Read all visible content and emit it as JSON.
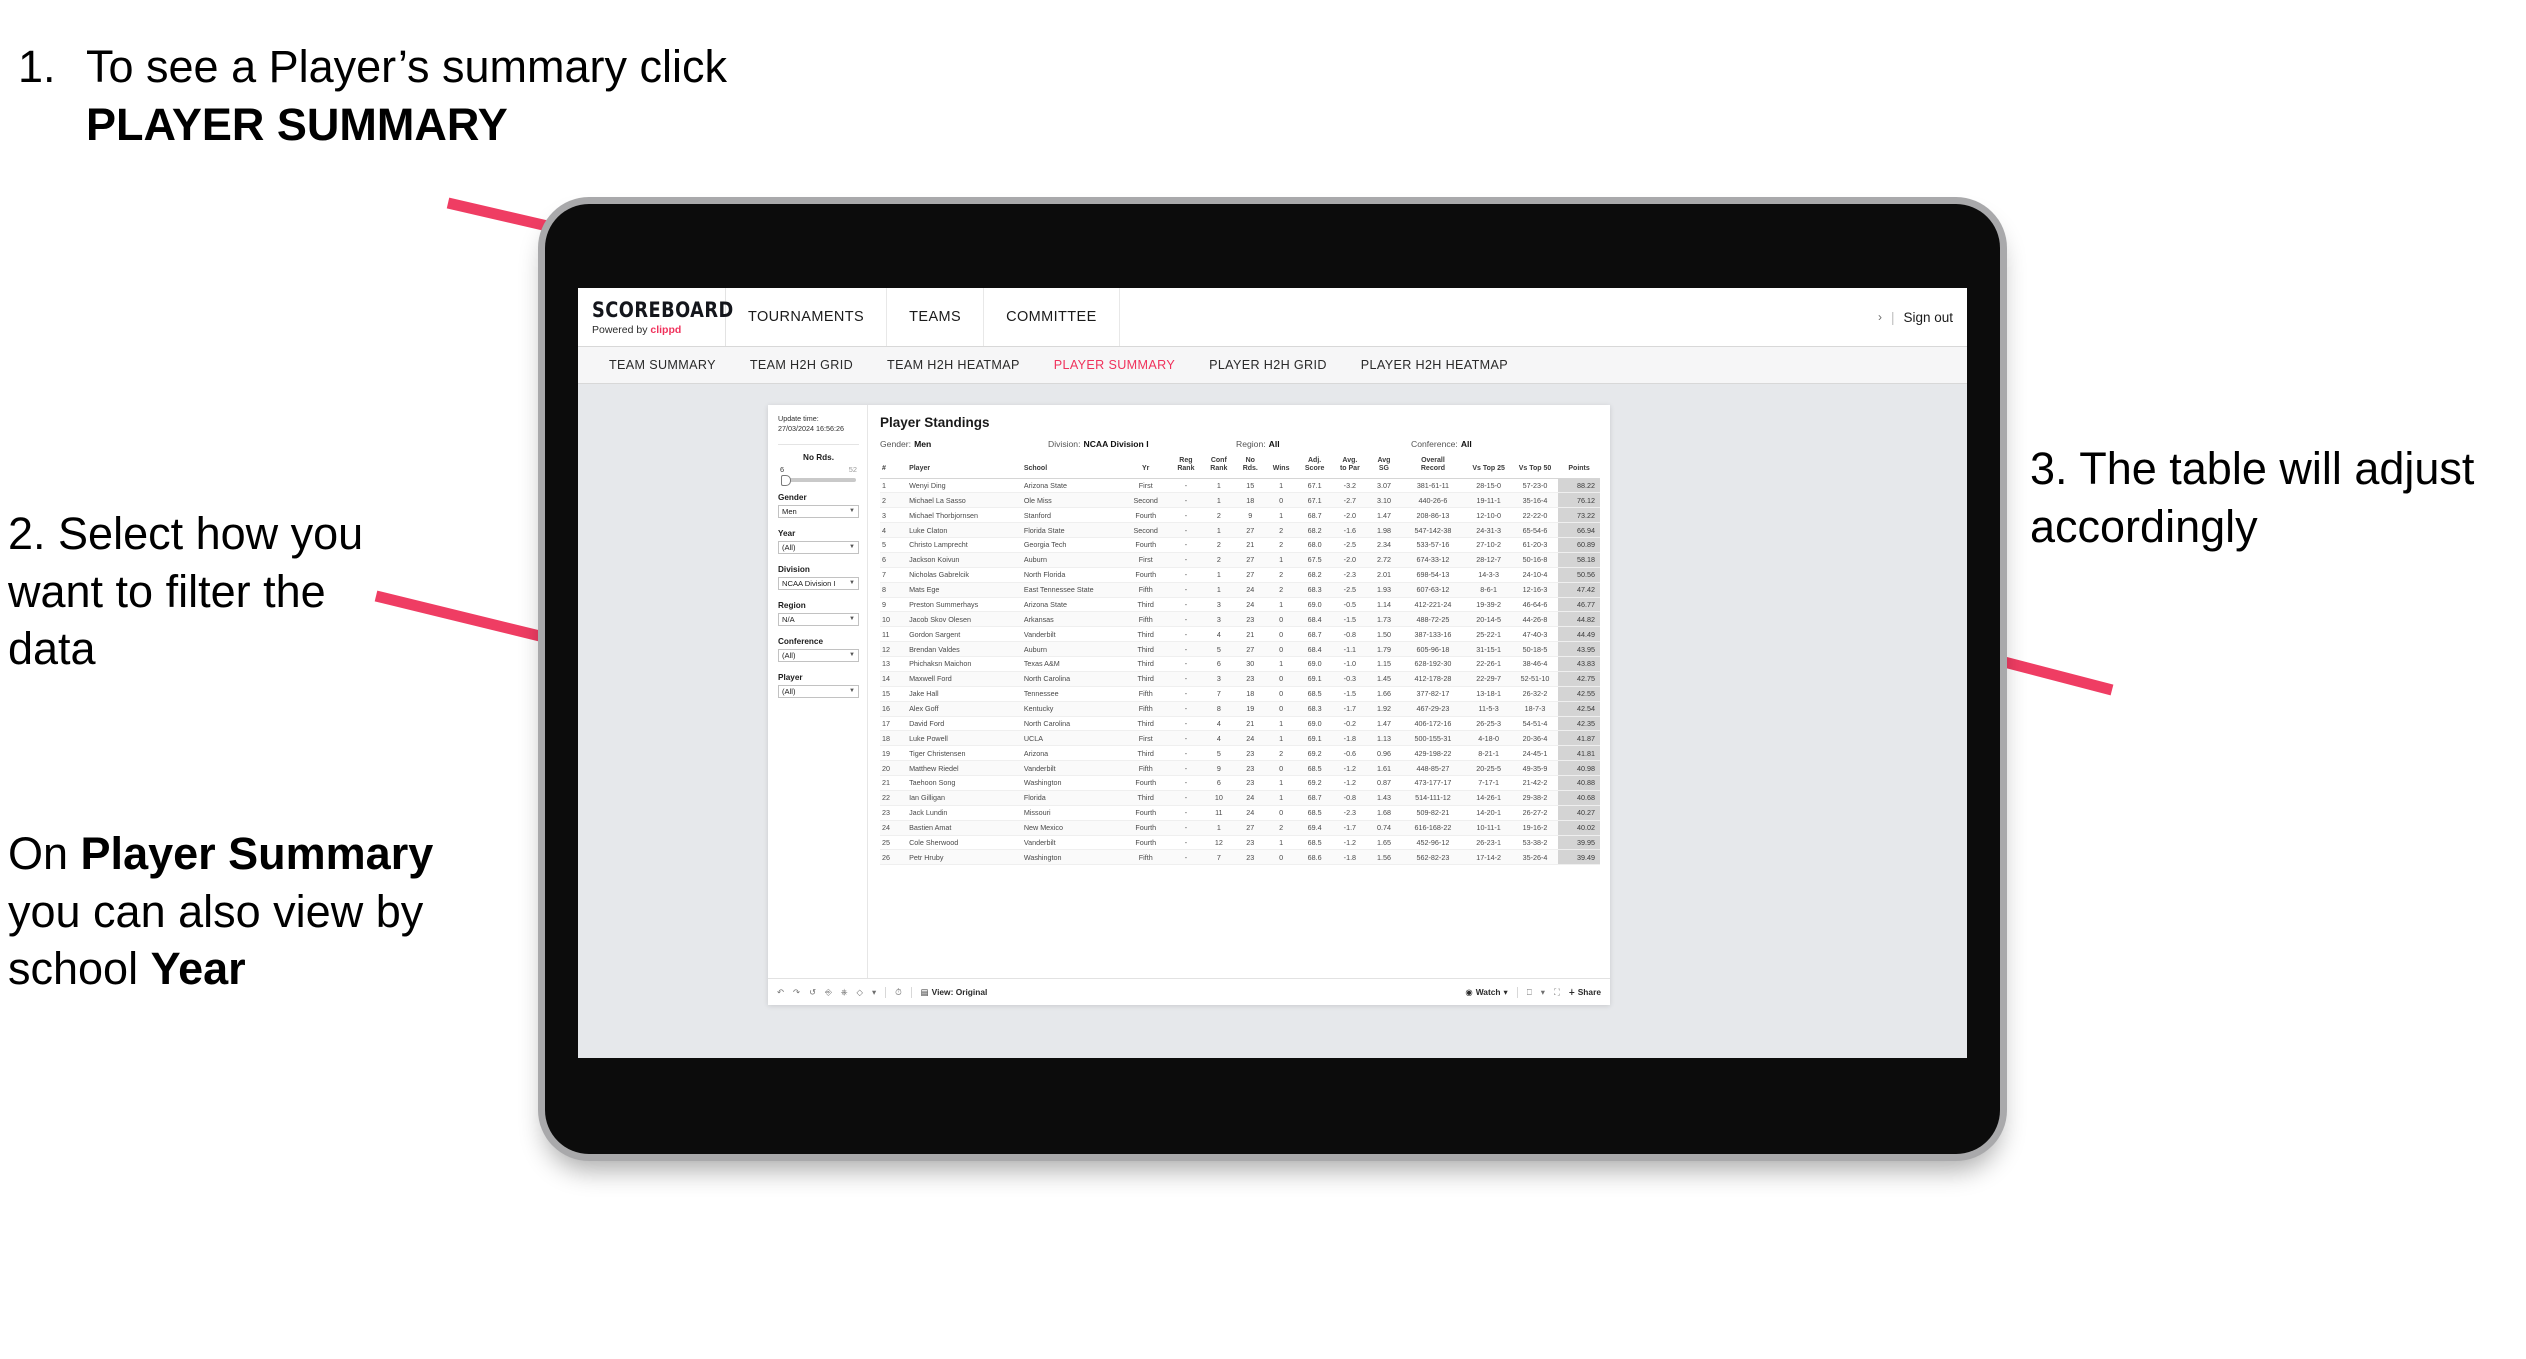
{
  "annotations": {
    "step1": {
      "number": "1.",
      "text_before": "To see a Player’s summary click ",
      "bold": "PLAYER SUMMARY"
    },
    "step2": {
      "text": "2. Select how you want to filter the data"
    },
    "step2b": {
      "p1": "On ",
      "b1": "Player Summary",
      "p2": " you can also view by school ",
      "b2": "Year"
    },
    "step3": {
      "text": "3. The table will adjust accordingly"
    },
    "arrow_color": "#ef3d63"
  },
  "app": {
    "brand": {
      "name": "SCOREBOARD",
      "powered_prefix": "Powered by ",
      "powered_brand": "clippd",
      "accent": "#f0325c"
    },
    "top_nav": [
      "TOURNAMENTS",
      "TEAMS",
      "COMMITTEE"
    ],
    "signout": {
      "caret": "›",
      "divider": "|",
      "label": "Sign out"
    },
    "sub_nav": [
      {
        "label": "TEAM SUMMARY",
        "active": false
      },
      {
        "label": "TEAM H2H GRID",
        "active": false
      },
      {
        "label": "TEAM H2H HEATMAP",
        "active": false
      },
      {
        "label": "PLAYER SUMMARY",
        "active": true
      },
      {
        "label": "PLAYER H2H GRID",
        "active": false
      },
      {
        "label": "PLAYER H2H HEATMAP",
        "active": false
      }
    ],
    "active_tab_color": "#f0325c"
  },
  "sidebar": {
    "update_label": "Update time:",
    "update_value": "27/03/2024 16:56:26",
    "slider": {
      "label": "No Rds.",
      "min": "6",
      "max": "52",
      "value": 6
    },
    "filters": [
      {
        "label": "Gender",
        "value": "Men"
      },
      {
        "label": "Year",
        "value": "(All)"
      },
      {
        "label": "Division",
        "value": "NCAA Division I"
      },
      {
        "label": "Region",
        "value": "N/A"
      },
      {
        "label": "Conference",
        "value": "(All)"
      },
      {
        "label": "Player",
        "value": "(All)"
      }
    ]
  },
  "viz": {
    "title": "Player Standings",
    "filter_summary": [
      {
        "label": "Gender:",
        "value": "Men"
      },
      {
        "label": "Division:",
        "value": "NCAA Division I"
      },
      {
        "label": "Region:",
        "value": "All"
      },
      {
        "label": "Conference:",
        "value": "All"
      }
    ],
    "columns": [
      {
        "key": "num",
        "l1": "#",
        "l2": ""
      },
      {
        "key": "player",
        "l1": "Player",
        "l2": ""
      },
      {
        "key": "school",
        "l1": "School",
        "l2": ""
      },
      {
        "key": "yr",
        "l1": "Yr",
        "l2": ""
      },
      {
        "key": "reg",
        "l1": "Reg",
        "l2": "Rank"
      },
      {
        "key": "conf",
        "l1": "Conf",
        "l2": "Rank"
      },
      {
        "key": "rds",
        "l1": "No",
        "l2": "Rds."
      },
      {
        "key": "wins",
        "l1": "Wins",
        "l2": ""
      },
      {
        "key": "adj",
        "l1": "Adj.",
        "l2": "Score"
      },
      {
        "key": "par",
        "l1": "Avg.",
        "l2": "to Par"
      },
      {
        "key": "sg",
        "l1": "Avg",
        "l2": "SG"
      },
      {
        "key": "rec",
        "l1": "Overall",
        "l2": "Record"
      },
      {
        "key": "t25",
        "l1": "Vs Top 25",
        "l2": ""
      },
      {
        "key": "t50",
        "l1": "Vs Top 50",
        "l2": ""
      },
      {
        "key": "pts",
        "l1": "Points",
        "l2": ""
      }
    ],
    "rows": [
      [
        "1",
        "Wenyi Ding",
        "Arizona State",
        "First",
        "-",
        "1",
        "15",
        "1",
        "67.1",
        "-3.2",
        "3.07",
        "381-61-11",
        "28-15-0",
        "57-23-0",
        "88.22"
      ],
      [
        "2",
        "Michael La Sasso",
        "Ole Miss",
        "Second",
        "-",
        "1",
        "18",
        "0",
        "67.1",
        "-2.7",
        "3.10",
        "440-26-6",
        "19-11-1",
        "35-16-4",
        "76.12"
      ],
      [
        "3",
        "Michael Thorbjornsen",
        "Stanford",
        "Fourth",
        "-",
        "2",
        "9",
        "1",
        "68.7",
        "-2.0",
        "1.47",
        "208-86-13",
        "12-10-0",
        "22-22-0",
        "73.22"
      ],
      [
        "4",
        "Luke Claton",
        "Florida State",
        "Second",
        "-",
        "1",
        "27",
        "2",
        "68.2",
        "-1.6",
        "1.98",
        "547-142-38",
        "24-31-3",
        "65-54-6",
        "66.94"
      ],
      [
        "5",
        "Christo Lamprecht",
        "Georgia Tech",
        "Fourth",
        "-",
        "2",
        "21",
        "2",
        "68.0",
        "-2.5",
        "2.34",
        "533-57-16",
        "27-10-2",
        "61-20-3",
        "60.89"
      ],
      [
        "6",
        "Jackson Koivun",
        "Auburn",
        "First",
        "-",
        "2",
        "27",
        "1",
        "67.5",
        "-2.0",
        "2.72",
        "674-33-12",
        "28-12-7",
        "50-16-8",
        "58.18"
      ],
      [
        "7",
        "Nicholas Gabrelcik",
        "North Florida",
        "Fourth",
        "-",
        "1",
        "27",
        "2",
        "68.2",
        "-2.3",
        "2.01",
        "698-54-13",
        "14-3-3",
        "24-10-4",
        "50.56"
      ],
      [
        "8",
        "Mats Ege",
        "East Tennessee State",
        "Fifth",
        "-",
        "1",
        "24",
        "2",
        "68.3",
        "-2.5",
        "1.93",
        "607-63-12",
        "8-6-1",
        "12-16-3",
        "47.42"
      ],
      [
        "9",
        "Preston Summerhays",
        "Arizona State",
        "Third",
        "-",
        "3",
        "24",
        "1",
        "69.0",
        "-0.5",
        "1.14",
        "412-221-24",
        "19-39-2",
        "46-64-6",
        "46.77"
      ],
      [
        "10",
        "Jacob Skov Olesen",
        "Arkansas",
        "Fifth",
        "-",
        "3",
        "23",
        "0",
        "68.4",
        "-1.5",
        "1.73",
        "488-72-25",
        "20-14-5",
        "44-26-8",
        "44.82"
      ],
      [
        "11",
        "Gordon Sargent",
        "Vanderbilt",
        "Third",
        "-",
        "4",
        "21",
        "0",
        "68.7",
        "-0.8",
        "1.50",
        "387-133-16",
        "25-22-1",
        "47-40-3",
        "44.49"
      ],
      [
        "12",
        "Brendan Valdes",
        "Auburn",
        "Third",
        "-",
        "5",
        "27",
        "0",
        "68.4",
        "-1.1",
        "1.79",
        "605-96-18",
        "31-15-1",
        "50-18-5",
        "43.95"
      ],
      [
        "13",
        "Phichaksn Maichon",
        "Texas A&M",
        "Third",
        "-",
        "6",
        "30",
        "1",
        "69.0",
        "-1.0",
        "1.15",
        "628-192-30",
        "22-26-1",
        "38-46-4",
        "43.83"
      ],
      [
        "14",
        "Maxwell Ford",
        "North Carolina",
        "Third",
        "-",
        "3",
        "23",
        "0",
        "69.1",
        "-0.3",
        "1.45",
        "412-178-28",
        "22-29-7",
        "52-51-10",
        "42.75"
      ],
      [
        "15",
        "Jake Hall",
        "Tennessee",
        "Fifth",
        "-",
        "7",
        "18",
        "0",
        "68.5",
        "-1.5",
        "1.66",
        "377-82-17",
        "13-18-1",
        "26-32-2",
        "42.55"
      ],
      [
        "16",
        "Alex Goff",
        "Kentucky",
        "Fifth",
        "-",
        "8",
        "19",
        "0",
        "68.3",
        "-1.7",
        "1.92",
        "467-29-23",
        "11-5-3",
        "18-7-3",
        "42.54"
      ],
      [
        "17",
        "David Ford",
        "North Carolina",
        "Third",
        "-",
        "4",
        "21",
        "1",
        "69.0",
        "-0.2",
        "1.47",
        "406-172-16",
        "26-25-3",
        "54-51-4",
        "42.35"
      ],
      [
        "18",
        "Luke Powell",
        "UCLA",
        "First",
        "-",
        "4",
        "24",
        "1",
        "69.1",
        "-1.8",
        "1.13",
        "500-155-31",
        "4-18-0",
        "20-36-4",
        "41.87"
      ],
      [
        "19",
        "Tiger Christensen",
        "Arizona",
        "Third",
        "-",
        "5",
        "23",
        "2",
        "69.2",
        "-0.6",
        "0.96",
        "429-198-22",
        "8-21-1",
        "24-45-1",
        "41.81"
      ],
      [
        "20",
        "Matthew Riedel",
        "Vanderbilt",
        "Fifth",
        "-",
        "9",
        "23",
        "0",
        "68.5",
        "-1.2",
        "1.61",
        "448-85-27",
        "20-25-5",
        "49-35-9",
        "40.98"
      ],
      [
        "21",
        "Taehoon Song",
        "Washington",
        "Fourth",
        "-",
        "6",
        "23",
        "1",
        "69.2",
        "-1.2",
        "0.87",
        "473-177-17",
        "7-17-1",
        "21-42-2",
        "40.88"
      ],
      [
        "22",
        "Ian Gilligan",
        "Florida",
        "Third",
        "-",
        "10",
        "24",
        "1",
        "68.7",
        "-0.8",
        "1.43",
        "514-111-12",
        "14-26-1",
        "29-38-2",
        "40.68"
      ],
      [
        "23",
        "Jack Lundin",
        "Missouri",
        "Fourth",
        "-",
        "11",
        "24",
        "0",
        "68.5",
        "-2.3",
        "1.68",
        "509-82-21",
        "14-20-1",
        "26-27-2",
        "40.27"
      ],
      [
        "24",
        "Bastien Amat",
        "New Mexico",
        "Fourth",
        "-",
        "1",
        "27",
        "2",
        "69.4",
        "-1.7",
        "0.74",
        "616-168-22",
        "10-11-1",
        "19-16-2",
        "40.02"
      ],
      [
        "25",
        "Cole Sherwood",
        "Vanderbilt",
        "Fourth",
        "-",
        "12",
        "23",
        "1",
        "68.5",
        "-1.2",
        "1.65",
        "452-96-12",
        "26-23-1",
        "53-38-2",
        "39.95"
      ],
      [
        "26",
        "Petr Hruby",
        "Washington",
        "Fifth",
        "-",
        "7",
        "23",
        "0",
        "68.6",
        "-1.8",
        "1.56",
        "562-82-23",
        "17-14-2",
        "35-26-4",
        "39.49"
      ]
    ]
  },
  "toolbar": {
    "view_label": "View: Original",
    "watch_label": "Watch",
    "share_label": "Share",
    "caret": "▾"
  }
}
